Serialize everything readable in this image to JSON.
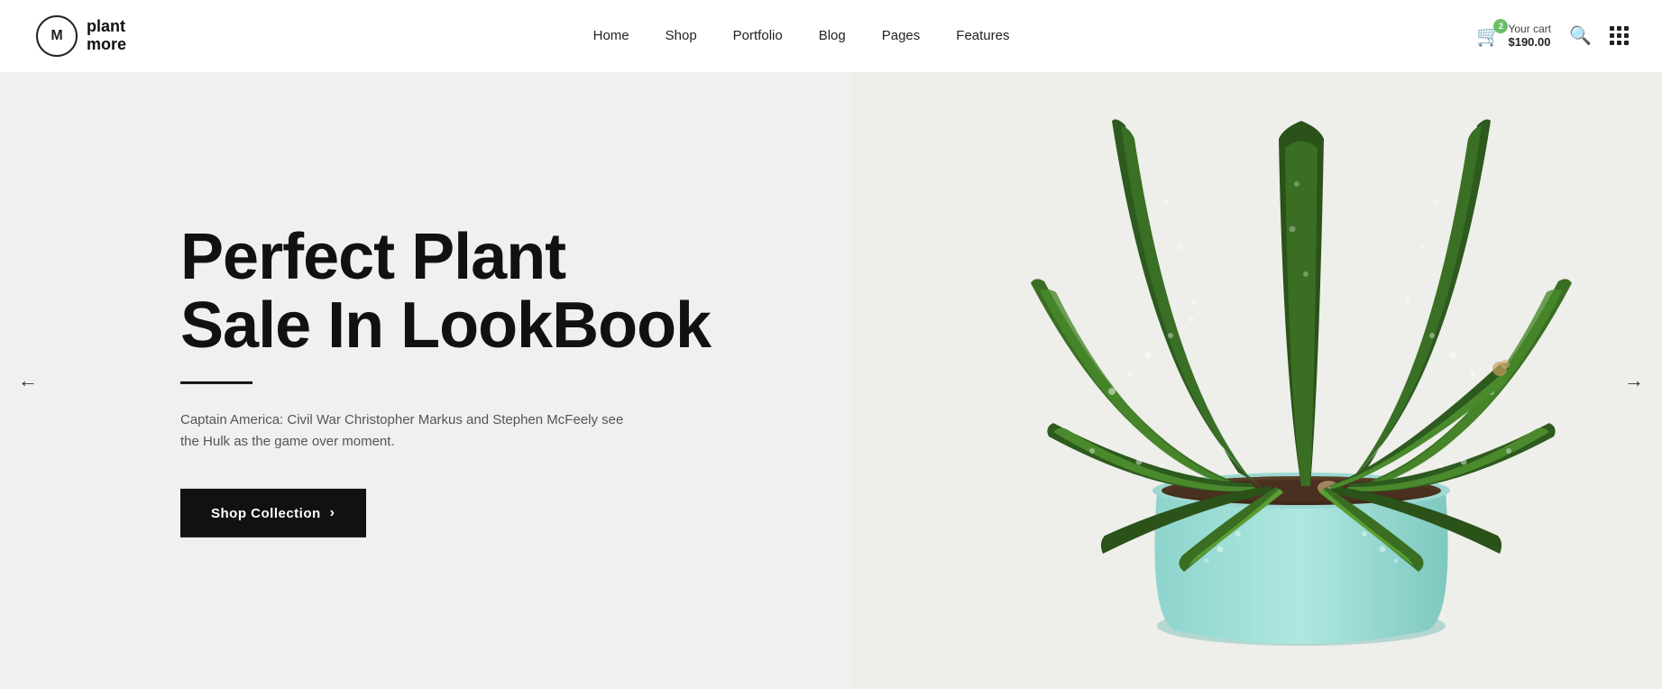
{
  "logo": {
    "circle_letter": "M",
    "line1": "plant",
    "line2": "more"
  },
  "nav": {
    "links": [
      {
        "label": "Home",
        "id": "home"
      },
      {
        "label": "Shop",
        "id": "shop"
      },
      {
        "label": "Portfolio",
        "id": "portfolio"
      },
      {
        "label": "Blog",
        "id": "blog"
      },
      {
        "label": "Pages",
        "id": "pages"
      },
      {
        "label": "Features",
        "id": "features"
      }
    ]
  },
  "cart": {
    "badge_count": "2",
    "label": "Your cart",
    "price": "$190.00"
  },
  "hero": {
    "title_line1": "Perfect Plant",
    "title_line2": "Sale In LookBook",
    "description": "Captain America: Civil War Christopher Markus and Stephen McFeely see the Hulk as the game over moment.",
    "button_label": "Shop Collection",
    "button_arrow": "›"
  },
  "arrows": {
    "left": "←",
    "right": "→"
  }
}
